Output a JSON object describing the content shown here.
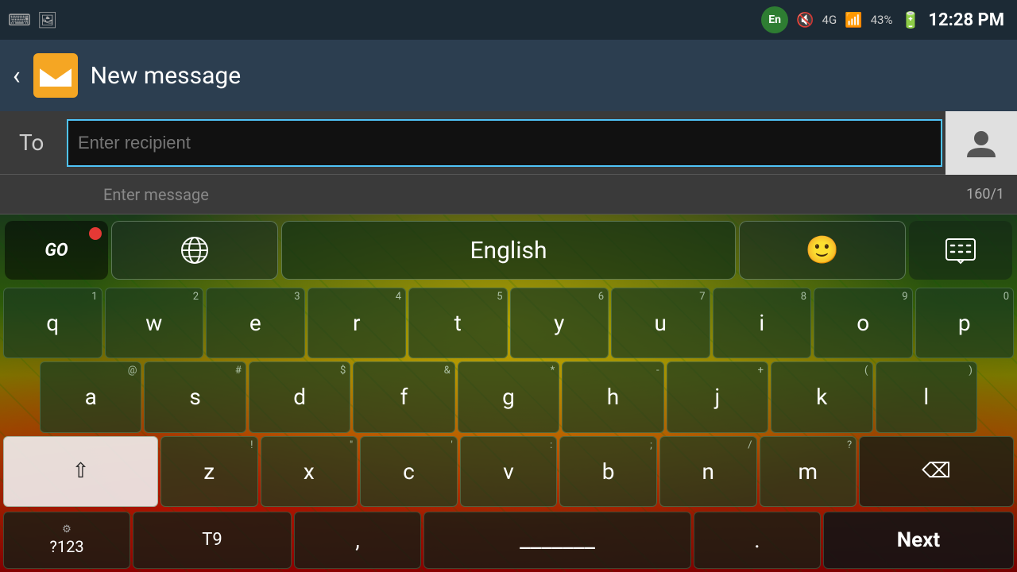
{
  "statusBar": {
    "en_label": "En",
    "network_type": "4G",
    "battery_pct": "43%",
    "time": "12:28 PM"
  },
  "appBar": {
    "title": "New message"
  },
  "toField": {
    "label": "To",
    "placeholder": "Enter recipient"
  },
  "messageField": {
    "placeholder": "Enter message",
    "char_count": "160/1"
  },
  "keyboard": {
    "english_label": "English",
    "next_label": "Next",
    "t9_label": "T9",
    "rows": [
      [
        "q",
        "w",
        "e",
        "r",
        "t",
        "y",
        "u",
        "i",
        "o",
        "p"
      ],
      [
        "a",
        "s",
        "d",
        "f",
        "g",
        "h",
        "j",
        "k",
        "l"
      ],
      [
        "z",
        "x",
        "c",
        "v",
        "b",
        "n",
        "m"
      ]
    ],
    "row_subs": [
      [
        "1",
        "2",
        "3",
        "4",
        "5",
        "6",
        "7",
        "8",
        "9",
        "0"
      ],
      [
        "@",
        "#",
        "$",
        "&",
        "*",
        "-",
        "+",
        "(",
        ")"
      ],
      [
        "!",
        "\"",
        "'",
        ":",
        ";",
        " /",
        "?"
      ]
    ],
    "bottom_sym": "?123",
    "comma": ",",
    "period": "."
  }
}
